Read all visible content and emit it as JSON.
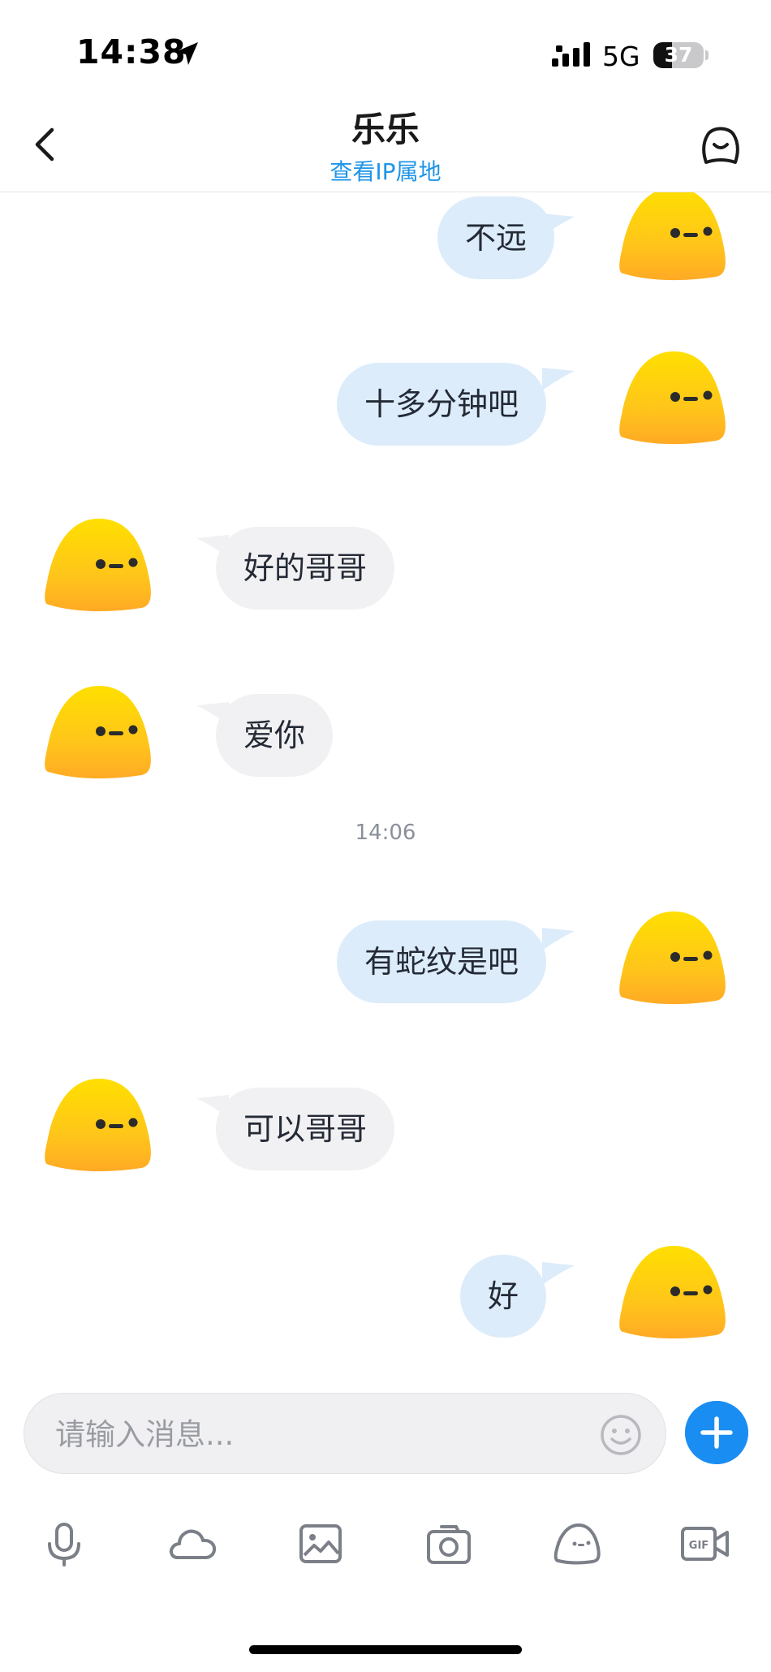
{
  "status": {
    "time": "14:38",
    "network": "5G",
    "battery": "37"
  },
  "header": {
    "title": "乐乐",
    "subtitle": "查看IP属地"
  },
  "messages": [
    {
      "side": "me",
      "text": "不远"
    },
    {
      "side": "me",
      "text": "十多分钟吧"
    },
    {
      "side": "other",
      "text": "好的哥哥"
    },
    {
      "side": "other",
      "text": "爱你"
    },
    {
      "side": "time",
      "text": "14:06"
    },
    {
      "side": "me",
      "text": "有蛇纹是吧"
    },
    {
      "side": "other",
      "text": "可以哥哥"
    },
    {
      "side": "me",
      "text": "好"
    }
  ],
  "input": {
    "placeholder": "请输入消息..."
  },
  "toolbar": [
    {
      "icon": "microphone-icon"
    },
    {
      "icon": "cloud-icon"
    },
    {
      "icon": "image-icon"
    },
    {
      "icon": "camera-icon"
    },
    {
      "icon": "sticker-icon"
    },
    {
      "icon": "gif-video-icon"
    }
  ],
  "colors": {
    "accent": "#1a8df2",
    "bubble_me": "#dcecfb",
    "bubble_other": "#f1f1f3",
    "link": "#1e95e8"
  }
}
